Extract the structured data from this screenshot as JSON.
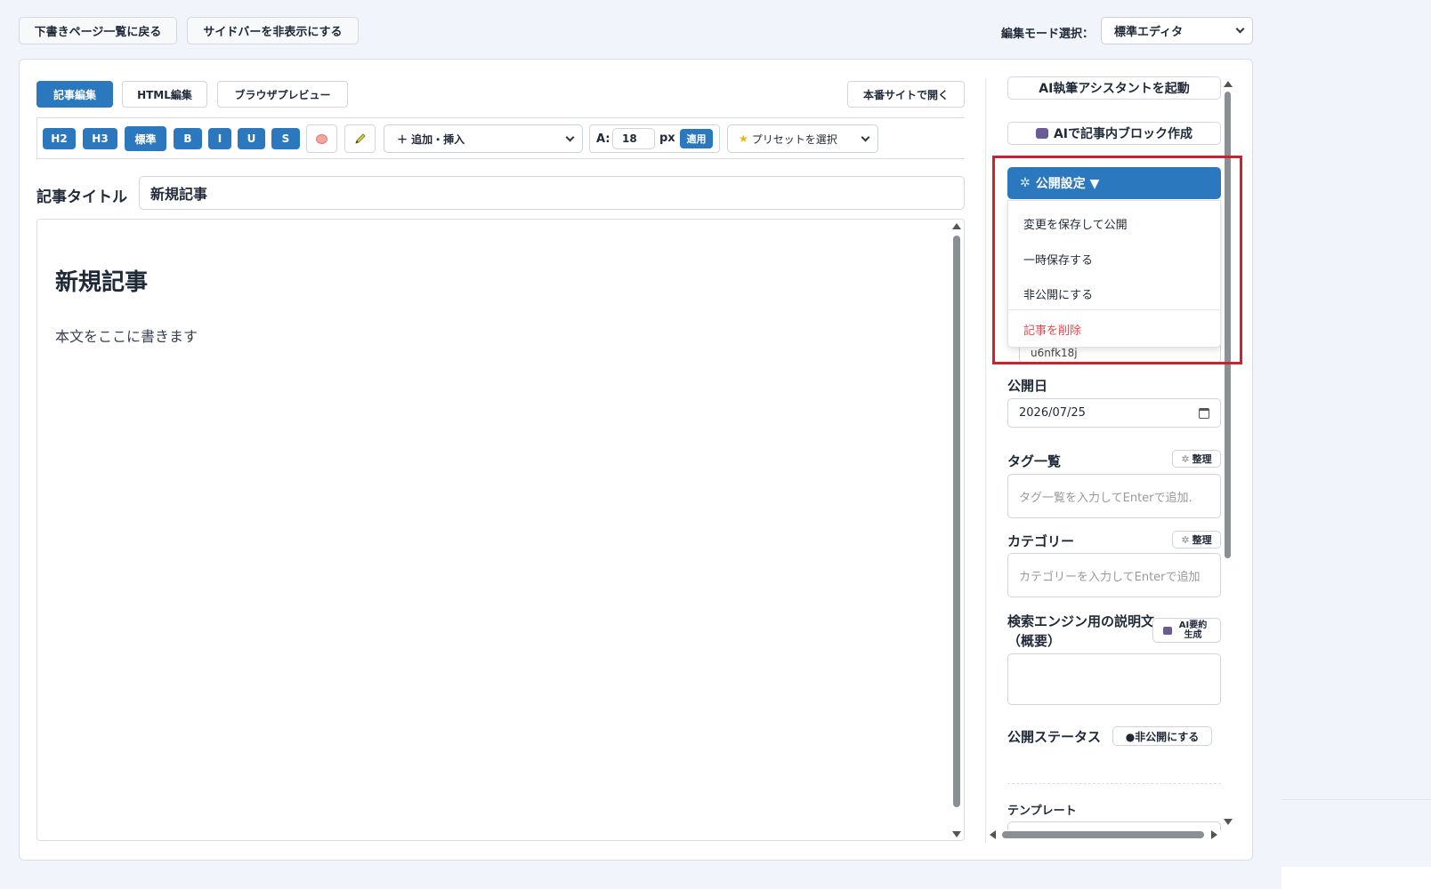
{
  "top_bar": {
    "back_label": "下書きページ一覧に戻る",
    "toggle_sidebar_label": "サイドバーを非表示にする",
    "mode_label": "編集モード選択：",
    "mode_value": "標準エディタ"
  },
  "tabs": [
    {
      "label": "記事編集",
      "active": true
    },
    {
      "label": "HTML編集",
      "active": false
    },
    {
      "label": "ブラウザプレビュー",
      "active": false
    }
  ],
  "open_live_label": "本番サイトで開く",
  "toolbar": {
    "h2": "H2",
    "h3": "H3",
    "normal": "標準",
    "bold": "B",
    "italic": "I",
    "underline": "U",
    "strike": "S",
    "insert_select": "＋ 追加・挿入",
    "font_size_label": "A:",
    "font_size_value": "18",
    "font_size_unit": "px",
    "apply_label": "適用",
    "preset_select": "プリセットを選択"
  },
  "article": {
    "title_label": "記事タイトル",
    "title_value": "新規記事",
    "content_heading": "新規記事",
    "content_body": "本文をここに書きます"
  },
  "sidebar": {
    "ai_assistant_label": "AI執筆アシスタントを起動",
    "ai_block_label": "AIで記事内ブロック作成",
    "publish_settings_label": "公開設定 ▼",
    "publish_menu": [
      {
        "label": "変更を保存して公開",
        "danger": false
      },
      {
        "label": "一時保存する",
        "danger": false
      },
      {
        "label": "非公開にする",
        "danger": false
      },
      {
        "label": "記事を削除",
        "danger": true
      }
    ],
    "slug_partial": "u6nfk18j",
    "publish_date_label": "公開日",
    "publish_date_value": "2026/07/25",
    "tags_label": "タグ一覧",
    "tags_manage": "整理",
    "tags_placeholder": "タグ一覧を入力してEnterで追加.",
    "category_label": "カテゴリー",
    "category_manage": "整理",
    "category_placeholder": "カテゴリーを入力してEnterで追加",
    "description_label": "検索エンジン用の説明文（概要）",
    "ai_summary_label": "AI要約生成",
    "status_label": "公開ステータス",
    "status_value": "●非公開にする",
    "template_label": "テンプレート"
  },
  "colors": {
    "accent": "#2c78bf",
    "danger": "#e5484d",
    "highlight": "#d0202e"
  }
}
